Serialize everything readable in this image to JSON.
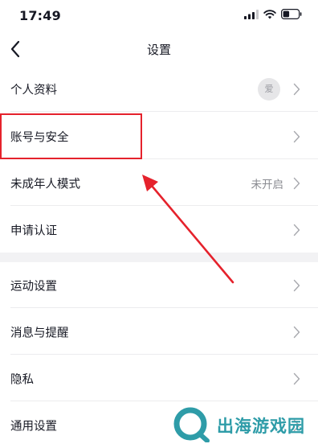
{
  "status_bar": {
    "time": "17:49",
    "icons": [
      "cellular-signal-icon",
      "wifi-icon",
      "battery-icon"
    ]
  },
  "nav": {
    "back_icon": "chevron-left-icon",
    "title": "设置"
  },
  "settings": {
    "items": [
      {
        "label": "个人资料",
        "avatar_text": "爱"
      },
      {
        "label": "账号与安全"
      },
      {
        "label": "未成年人模式",
        "value": "未开启"
      },
      {
        "label": "申请认证"
      },
      {
        "label": "运动设置"
      },
      {
        "label": "消息与提醒"
      },
      {
        "label": "隐私"
      },
      {
        "label": "通用设置"
      }
    ]
  },
  "annotation": {
    "highlight_color": "#e5222c"
  },
  "watermark": {
    "text": "出海游戏园",
    "color": "#2e9ca8"
  }
}
